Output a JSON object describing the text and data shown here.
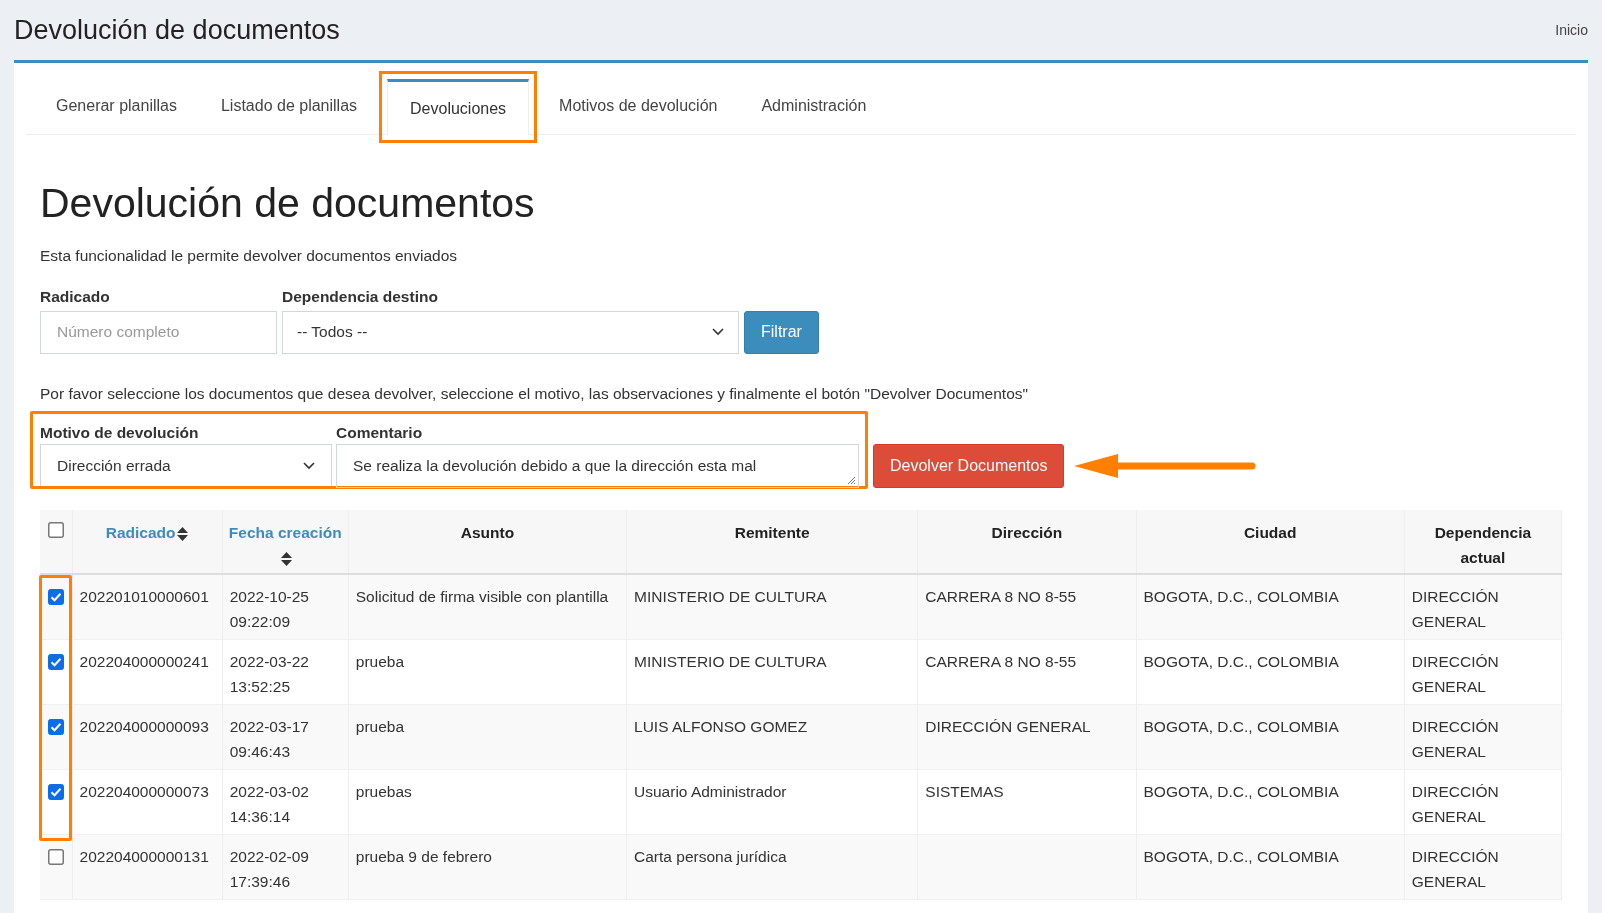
{
  "header": {
    "title": "Devolución de documentos",
    "breadcrumb": "Inicio"
  },
  "tabs": [
    {
      "label": "Generar planillas",
      "selected": false
    },
    {
      "label": "Listado de planillas",
      "selected": false
    },
    {
      "label": "Devoluciones",
      "selected": true
    },
    {
      "label": "Motivos de devolución",
      "selected": false
    },
    {
      "label": "Administración",
      "selected": false
    }
  ],
  "page": {
    "heading": "Devolución de documentos",
    "description": "Esta funcionalidad le permite devolver documentos enviados"
  },
  "filter": {
    "radicado_label": "Radicado",
    "radicado_placeholder": "Número completo",
    "dependencia_label": "Dependencia destino",
    "dependencia_value": "-- Todos --",
    "button": "Filtrar"
  },
  "instructions": "Por favor seleccione los documentos que desea devolver, seleccione el motivo, las observaciones y finalmente el botón \"Devolver Documentos\"",
  "return_form": {
    "motivo_label": "Motivo de devolución",
    "motivo_value": "Dirección errada",
    "comentario_label": "Comentario",
    "comentario_value": "Se realiza la devolución debido a que la dirección esta mal",
    "button": "Devolver Documentos"
  },
  "table": {
    "select_all": {
      "checked": false
    },
    "columns": [
      {
        "label": "Radicado",
        "sortable": true
      },
      {
        "label": "Fecha creación",
        "sortable": true
      },
      {
        "label": "Asunto",
        "sortable": false
      },
      {
        "label": "Remitente",
        "sortable": false
      },
      {
        "label": "Dirección",
        "sortable": false
      },
      {
        "label": "Ciudad",
        "sortable": false
      },
      {
        "label": "Dependencia actual",
        "sortable": false
      }
    ],
    "rows": [
      {
        "checked": true,
        "cells": [
          "202201010000601",
          "2022-10-25 09:22:09",
          "Solicitud de firma visible con plantilla",
          "MINISTERIO DE CULTURA",
          "CARRERA 8 NO 8-55",
          "BOGOTA, D.C., COLOMBIA",
          "DIRECCIÓN GENERAL"
        ]
      },
      {
        "checked": true,
        "cells": [
          "202204000000241",
          "2022-03-22 13:52:25",
          "prueba",
          "MINISTERIO DE CULTURA",
          "CARRERA 8 NO 8-55",
          "BOGOTA, D.C., COLOMBIA",
          "DIRECCIÓN GENERAL"
        ]
      },
      {
        "checked": true,
        "cells": [
          "202204000000093",
          "2022-03-17 09:46:43",
          "prueba",
          "LUIS ALFONSO GOMEZ",
          "DIRECCIÓN GENERAL",
          "BOGOTA, D.C., COLOMBIA",
          "DIRECCIÓN GENERAL"
        ]
      },
      {
        "checked": true,
        "cells": [
          "202204000000073",
          "2022-03-02 14:36:14",
          "pruebas",
          "Usuario Administrador",
          "SISTEMAS",
          "BOGOTA, D.C., COLOMBIA",
          "DIRECCIÓN GENERAL"
        ]
      },
      {
        "checked": false,
        "cells": [
          "202204000000131",
          "2022-02-09 17:39:46",
          "prueba 9 de febrero",
          "Carta persona jurídica",
          "",
          "BOGOTA, D.C., COLOMBIA",
          "DIRECCIÓN GENERAL"
        ]
      }
    ]
  }
}
